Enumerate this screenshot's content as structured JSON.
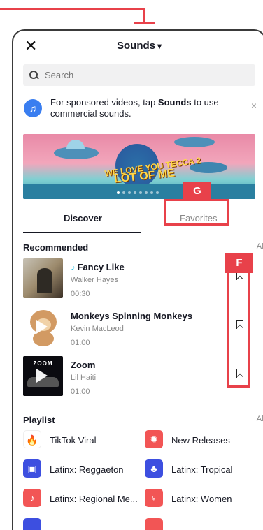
{
  "header": {
    "title": "Sounds",
    "close_label": "✕",
    "title_chevron": "▾"
  },
  "search": {
    "placeholder": "Search"
  },
  "notice": {
    "text_before": "For sponsored videos, tap ",
    "text_bold": "Sounds",
    "text_after": " to use commercial sounds.",
    "close": "×"
  },
  "banner": {
    "line1": "WE LOVE YOU TECCA 2",
    "line2": "LOT OF ME"
  },
  "tabs": [
    {
      "label": "Discover"
    },
    {
      "label": "Favorites"
    }
  ],
  "annotations": {
    "g": "G",
    "f": "F"
  },
  "recommended": {
    "title": "Recommended",
    "all_label": "All",
    "tracks": [
      {
        "name": "Fancy Like",
        "artist": "Walker Hayes",
        "duration": "00:30"
      },
      {
        "name": "Monkeys Spinning Monkeys",
        "artist": "Kevin MacLeod",
        "duration": "01:00"
      },
      {
        "name": "Zoom",
        "artist": "Lil Haiti",
        "duration": "01:00",
        "cover_text": "ZOOM"
      }
    ]
  },
  "playlist": {
    "title": "Playlist",
    "all_label": "All",
    "items": [
      {
        "label": "TikTok Viral",
        "icon": "flame-icon",
        "color": "#ffffff"
      },
      {
        "label": "New Releases",
        "icon": "badge-exclamation-icon",
        "color": "#f25555"
      },
      {
        "label": "Latinx: Reggaeton",
        "icon": "boombox-icon",
        "color": "#3d4fe0"
      },
      {
        "label": "Latinx: Tropical",
        "icon": "palm-tree-icon",
        "color": "#3d4fe0"
      },
      {
        "label": "Latinx: Regional Me...",
        "icon": "guitar-icon",
        "color": "#f25555"
      },
      {
        "label": "Latinx: Women",
        "icon": "female-symbol-icon",
        "color": "#f25555"
      }
    ]
  },
  "colors": {
    "annotation": "#e8414a",
    "tiktok_accent": "#25c3e6"
  }
}
